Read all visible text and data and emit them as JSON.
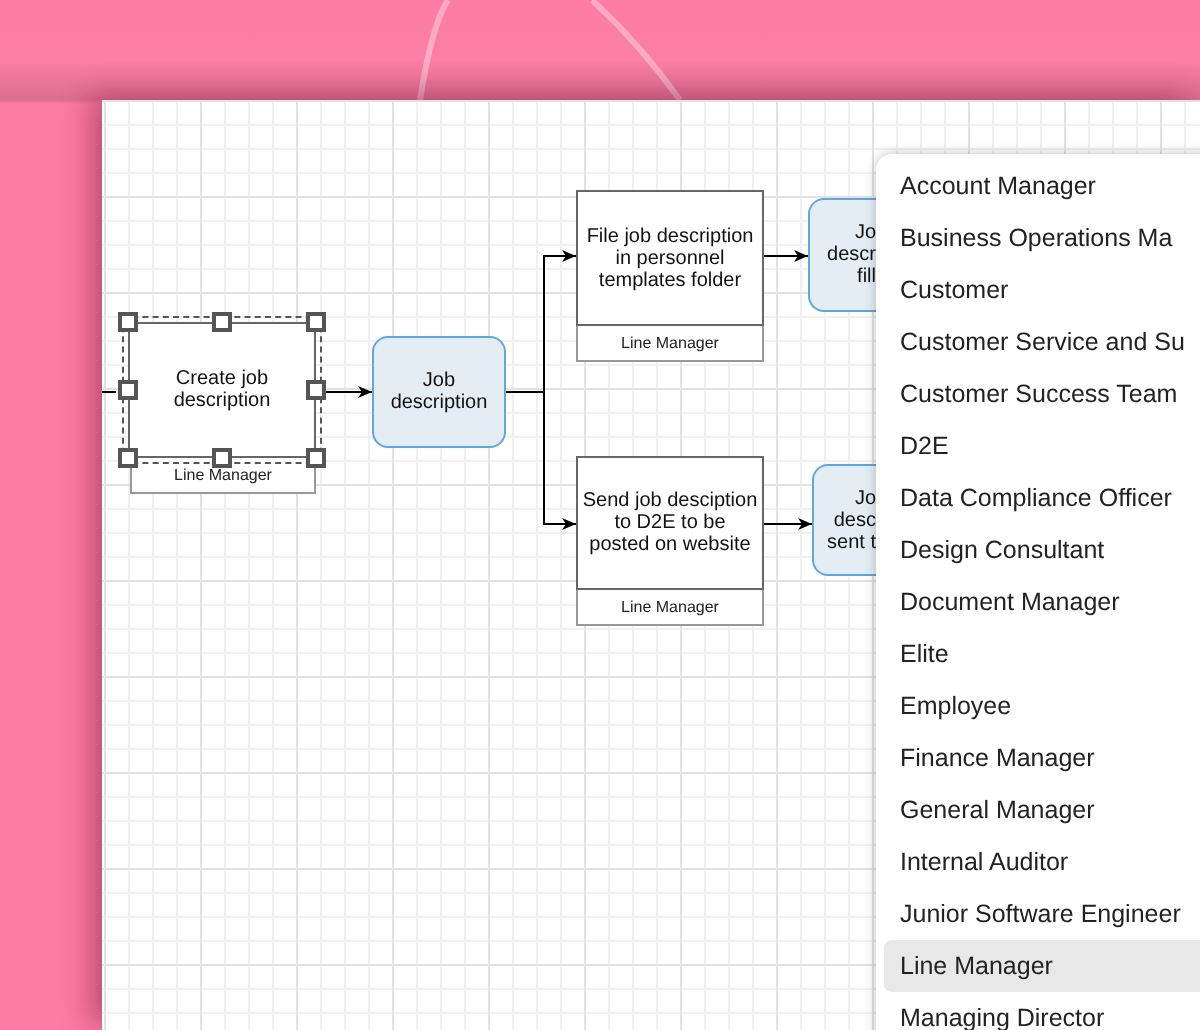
{
  "diagram": {
    "nodes": [
      {
        "kind": "process",
        "lines": [
          "Create job",
          "description"
        ],
        "lane": "Line Manager",
        "selected": true
      },
      {
        "kind": "data",
        "lines": [
          "Job",
          "description"
        ],
        "selected": false
      },
      {
        "kind": "process",
        "lines": [
          "File job description",
          "in personnel",
          "templates folder"
        ],
        "lane": "Line Manager",
        "selected": false
      },
      {
        "kind": "process",
        "lines": [
          "Send job desciption",
          "to D2E to be",
          "posted on website"
        ],
        "lane": "Line Manager",
        "selected": false
      },
      {
        "kind": "data",
        "lines": [
          "Jo",
          "descr",
          "fill"
        ],
        "selected": false
      },
      {
        "kind": "data",
        "lines": [
          "Jo",
          "desc",
          "sent t"
        ],
        "selected": false
      }
    ]
  },
  "role_menu": {
    "items": [
      {
        "label": "Account Manager",
        "selected": false
      },
      {
        "label": "Business Operations Ma",
        "selected": false
      },
      {
        "label": "Customer",
        "selected": false
      },
      {
        "label": "Customer Service and Su",
        "selected": false
      },
      {
        "label": "Customer Success Team",
        "selected": false
      },
      {
        "label": "D2E",
        "selected": false
      },
      {
        "label": "Data Compliance Officer",
        "selected": false
      },
      {
        "label": "Design Consultant",
        "selected": false
      },
      {
        "label": "Document Manager",
        "selected": false
      },
      {
        "label": "Elite",
        "selected": false
      },
      {
        "label": "Employee",
        "selected": false
      },
      {
        "label": "Finance Manager",
        "selected": false
      },
      {
        "label": "General Manager",
        "selected": false
      },
      {
        "label": "Internal Auditor",
        "selected": false
      },
      {
        "label": "Junior Software Engineer",
        "selected": false
      },
      {
        "label": "Line Manager",
        "selected": true
      },
      {
        "label": "Managing Director",
        "selected": false
      }
    ]
  }
}
